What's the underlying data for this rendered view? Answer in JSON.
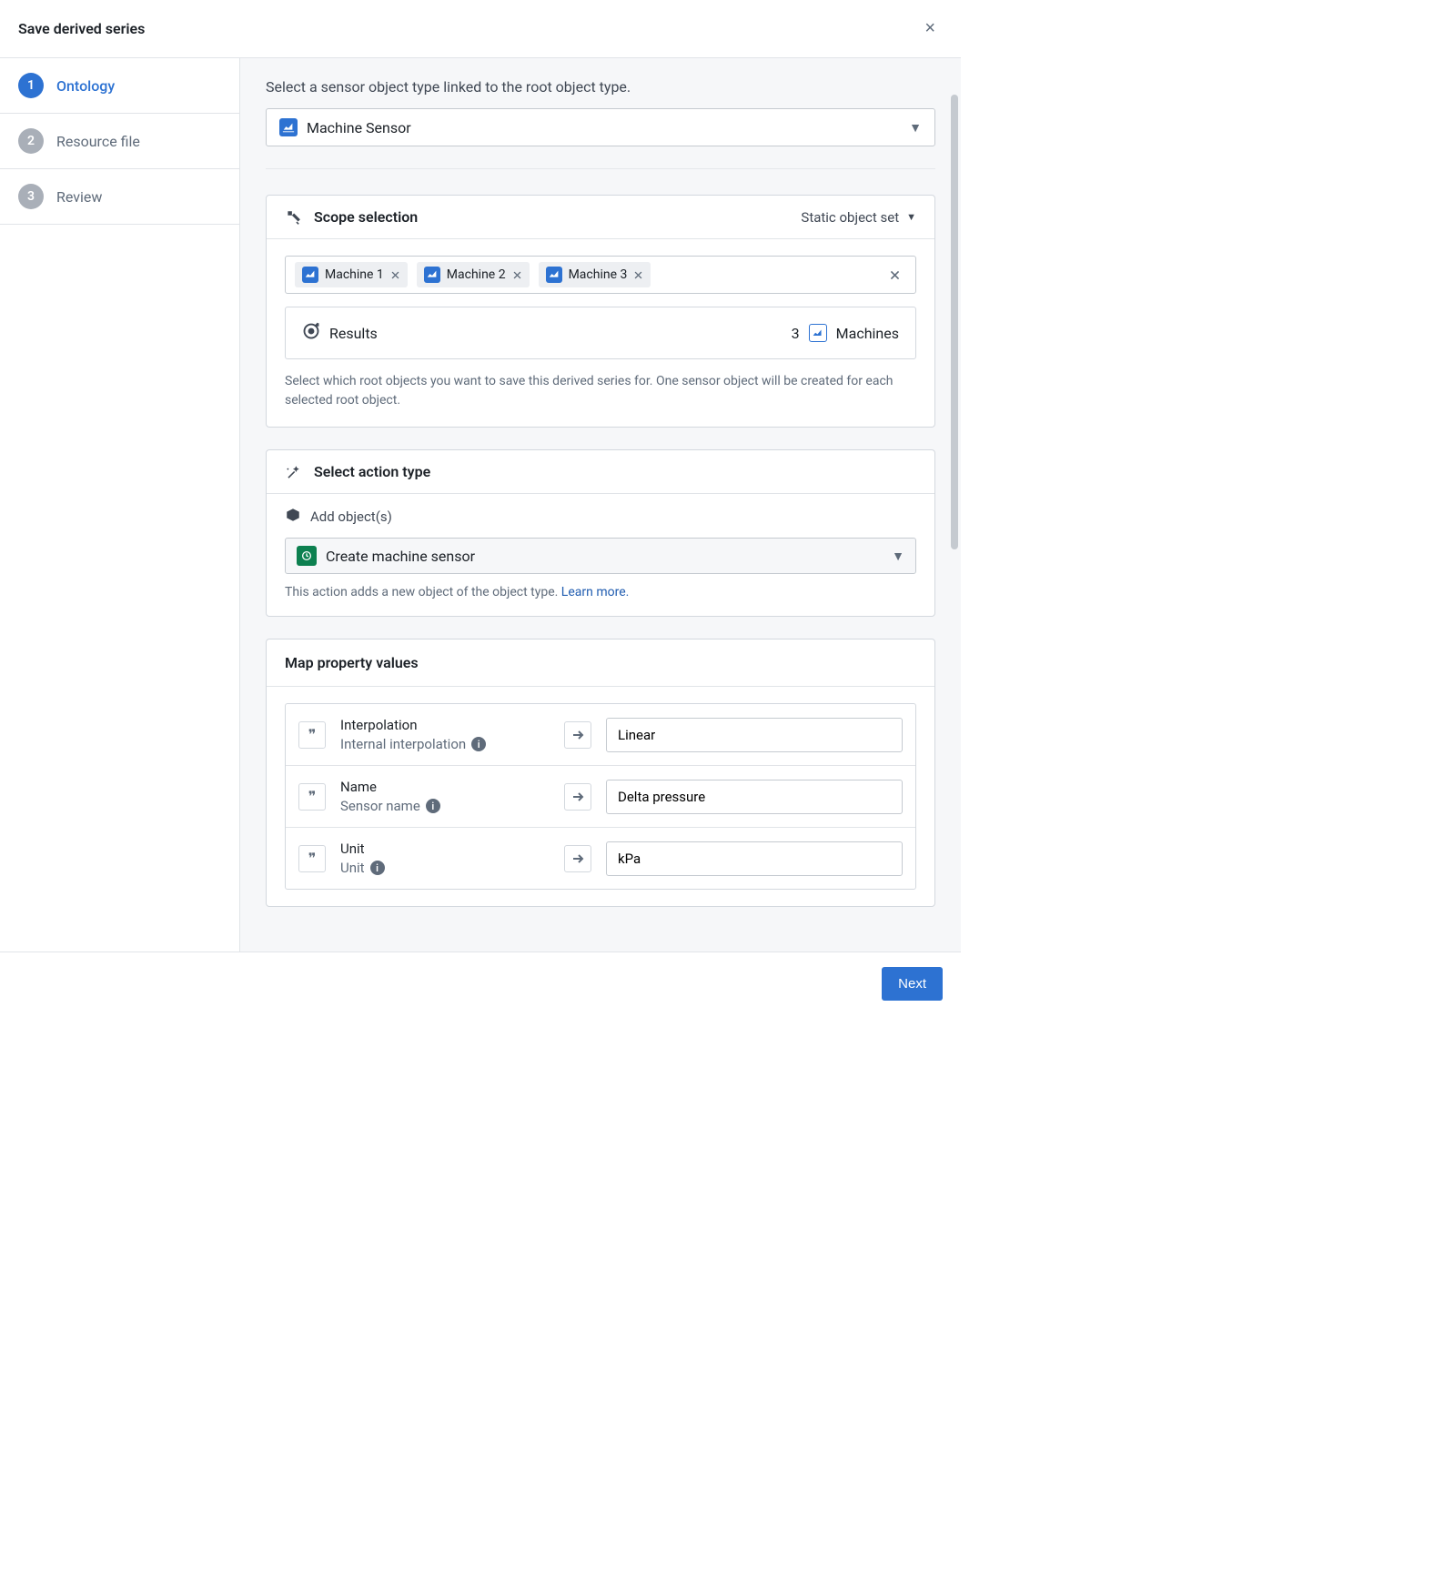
{
  "dialog": {
    "title": "Save derived series",
    "close": "×"
  },
  "steps": [
    {
      "num": "1",
      "label": "Ontology",
      "state": "active"
    },
    {
      "num": "2",
      "label": "Resource file",
      "state": "inactive"
    },
    {
      "num": "3",
      "label": "Review",
      "state": "inactive"
    }
  ],
  "intro": "Select a sensor object type linked to the root object type.",
  "sensor_select": {
    "label": "Machine Sensor"
  },
  "scope": {
    "title": "Scope selection",
    "mode": "Static object set",
    "tags": [
      "Machine 1",
      "Machine 2",
      "Machine 3"
    ],
    "results_label": "Results",
    "results_count": "3",
    "results_type": "Machines",
    "helper": "Select which root objects you want to save this derived series for. One sensor object will be created for each selected root object."
  },
  "action": {
    "title": "Select action type",
    "sub": "Add object(s)",
    "select_label": "Create machine sensor",
    "hint": "This action adds a new object of the object type. ",
    "learn": "Learn more."
  },
  "map": {
    "title": "Map property values",
    "rows": [
      {
        "label1": "Interpolation",
        "label2": "Internal interpolation",
        "value": "Linear"
      },
      {
        "label1": "Name",
        "label2": "Sensor name",
        "value": "Delta pressure"
      },
      {
        "label1": "Unit",
        "label2": "Unit",
        "value": "kPa"
      }
    ]
  },
  "footer": {
    "next": "Next"
  }
}
